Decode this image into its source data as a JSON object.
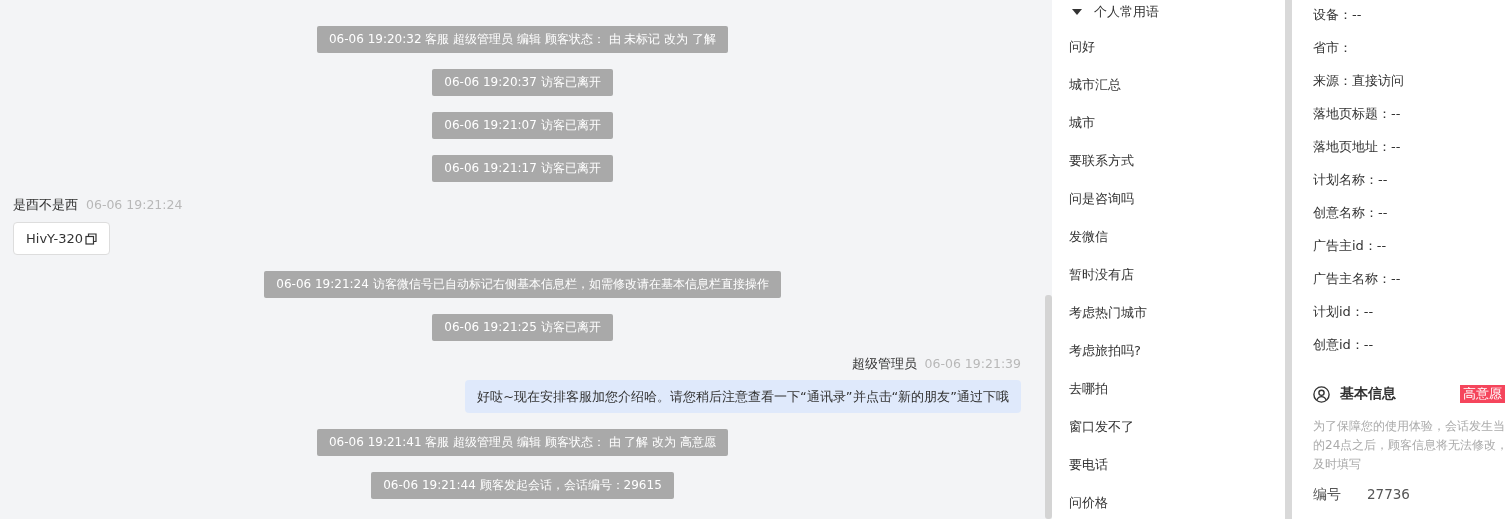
{
  "chat": {
    "messages": [
      {
        "kind": "system",
        "text": "06-06 19:20:32 客服 超级管理员 编辑 顾客状态： 由 未标记 改为 了解"
      },
      {
        "kind": "system",
        "text": "06-06 19:20:37 访客已离开"
      },
      {
        "kind": "system",
        "text": "06-06 19:21:07 访客已离开"
      },
      {
        "kind": "system",
        "text": "06-06 19:21:17 访客已离开"
      },
      {
        "kind": "visitor",
        "name": "是酉不是西",
        "time": "06-06 19:21:24",
        "text": "HivY-320"
      },
      {
        "kind": "system",
        "text": "06-06 19:21:24 访客微信号已自动标记右侧基本信息栏，如需修改请在基本信息栏直接操作"
      },
      {
        "kind": "system",
        "text": "06-06 19:21:25 访客已离开"
      },
      {
        "kind": "agent",
        "name": "超级管理员",
        "time": "06-06 19:21:39",
        "text": "好哒~现在安排客服加您介绍哈。请您稍后注意查看一下“通讯录”并点击“新的朋友”通过下哦"
      },
      {
        "kind": "system",
        "text": "06-06 19:21:41 客服 超级管理员 编辑 顾客状态： 由 了解 改为 高意愿"
      },
      {
        "kind": "system",
        "text": "06-06 19:21:44 顾客发起会话，会话编号：29615"
      }
    ]
  },
  "phrases": {
    "group": "个人常用语",
    "expanded": true,
    "items": [
      "问好",
      "城市汇总",
      "城市",
      "要联系方式",
      "问是咨询吗",
      "发微信",
      "暂时没有店",
      "考虑热门城市",
      "考虑旅拍吗?",
      "去哪拍",
      "窗口发不了",
      "要电话",
      "问价格"
    ]
  },
  "info": {
    "fields": [
      "设备：--",
      "省市：",
      "来源：直接访问",
      "落地页标题：--",
      "落地页地址：--",
      "计划名称：--",
      "创意名称：--",
      "广告主id：--",
      "广告主名称：--",
      "计划id：--",
      "创意id：--"
    ],
    "section_title": "基本信息",
    "badge": "高意愿",
    "note_lines": [
      "为了保障您的使用体验，会话发生当",
      "的24点之后，顾客信息将无法修改，",
      "及时填写"
    ],
    "id_label": "编号",
    "id_value": "27736"
  }
}
